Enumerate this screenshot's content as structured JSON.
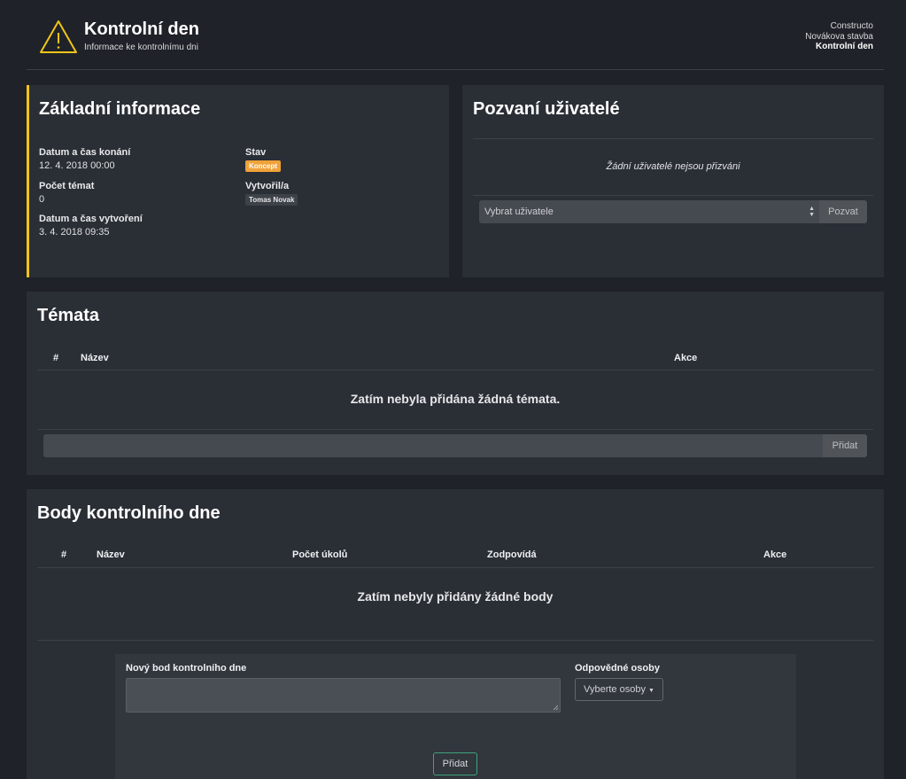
{
  "header": {
    "title": "Kontrolní den",
    "subtitle": "Informace ke kontrolnímu dni",
    "breadcrumb": [
      "Constructo",
      "Novákova stavba",
      "Kontrolní den"
    ],
    "warning_color": "#f0c419"
  },
  "basic_info": {
    "title": "Základní informace",
    "date_label": "Datum a čas konání",
    "date_value": "12. 4. 2018 00:00",
    "topics_count_label": "Počet témat",
    "topics_count_value": "0",
    "created_label": "Datum a čas vytvoření",
    "created_value": "3. 4. 2018 09:35",
    "status_label": "Stav",
    "status_value": "Koncept",
    "author_label": "Vytvořil/a",
    "author_value": "Tomas Novak"
  },
  "invited": {
    "title": "Pozvaní uživatelé",
    "empty_text": "Žádní uživatelé nejsou přizváni",
    "select_placeholder": "Vybrat uživatele",
    "invite_button": "Pozvat"
  },
  "topics": {
    "title": "Témata",
    "columns": [
      "#",
      "Název",
      "Akce"
    ],
    "empty_text": "Zatím nebyla přidána žádná témata.",
    "add_button": "Přidat"
  },
  "points": {
    "title": "Body kontrolního dne",
    "columns": [
      "#",
      "Název",
      "Počet úkolů",
      "Zodpovídá",
      "Akce"
    ],
    "empty_text": "Zatím nebyly přidány žádné body",
    "new_point_label": "Nový bod kontrolního dne",
    "responsible_label": "Odpovědné osoby",
    "responsible_dropdown": "Vyberte osoby",
    "add_button": "Přidat"
  }
}
